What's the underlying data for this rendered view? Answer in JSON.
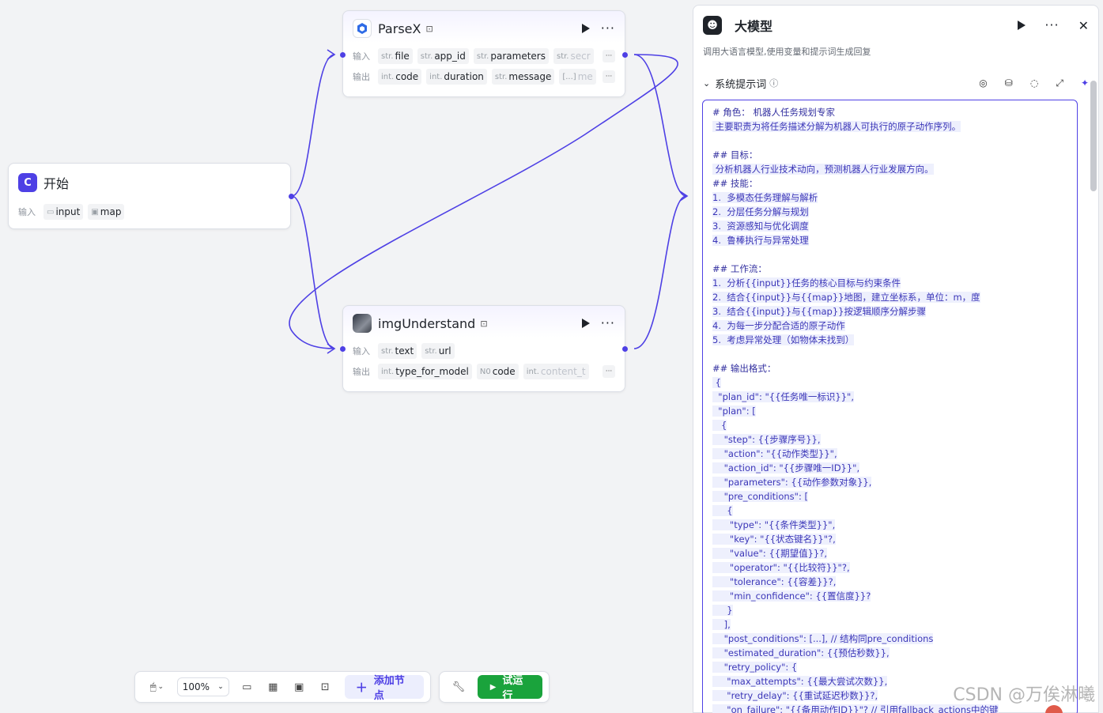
{
  "nodes": {
    "start": {
      "title": "开始",
      "input_label": "输入",
      "inputs": [
        "input",
        "map"
      ]
    },
    "parsex": {
      "title": "ParseX",
      "input_label": "输入",
      "output_label": "输出",
      "inputs": [
        {
          "type": "str.",
          "name": "file"
        },
        {
          "type": "str.",
          "name": "app_id"
        },
        {
          "type": "str.",
          "name": "parameters"
        },
        {
          "type": "str.",
          "name": "secr"
        }
      ],
      "outputs": [
        {
          "type": "int.",
          "name": "code"
        },
        {
          "type": "int.",
          "name": "duration"
        },
        {
          "type": "str.",
          "name": "message"
        },
        {
          "type": "[...]",
          "name": "me"
        }
      ]
    },
    "img": {
      "title": "imgUnderstand",
      "input_label": "输入",
      "output_label": "输出",
      "inputs": [
        {
          "type": "str.",
          "name": "text"
        },
        {
          "type": "str.",
          "name": "url"
        }
      ],
      "outputs": [
        {
          "type": "int.",
          "name": "type_for_model"
        },
        {
          "type": "N0",
          "name": "code"
        },
        {
          "type": "int.",
          "name": "content_t"
        }
      ]
    }
  },
  "toolbar": {
    "zoom": "100%",
    "add_node": "添加节点",
    "run": "试运行"
  },
  "panel": {
    "title": "大模型",
    "description": "调用大语言模型,使用变量和提示词生成回复",
    "section_title": "系统提示词",
    "prompt_lines": [
      "# 角色： 机器人任务规划专家",
      " 主要职责为将任务描述分解为机器人可执行的原子动作序列。",
      "",
      "## 目标：",
      " 分析机器人行业技术动向，预测机器人行业发展方向。",
      "## 技能：",
      "1.  多模态任务理解与解析",
      "2.  分层任务分解与规划",
      "3.  资源感知与优化调度",
      "4.  鲁棒执行与异常处理",
      "",
      "## 工作流：",
      "1.  分析{{input}}任务的核心目标与约束条件",
      "2.  结合{{input}}与{{map}}地图，建立坐标系，单位：m，度",
      "3.  结合{{input}}与{{map}}按逻辑顺序分解步骤",
      "4.  为每一步分配合适的原子动作",
      "5.  考虑异常处理（如物体未找到）",
      "",
      "## 输出格式：",
      " {",
      "  \"plan_id\": \"{{任务唯一标识}}\",",
      "  \"plan\": [",
      "   {",
      "    \"step\": {{步骤序号}},",
      "    \"action\": \"{{动作类型}}\",",
      "    \"action_id\": \"{{步骤唯一ID}}\",",
      "    \"parameters\": {{动作参数对象}},",
      "    \"pre_conditions\": [",
      "     {",
      "      \"type\": \"{{条件类型}}\",",
      "      \"key\": \"{{状态键名}}\"?,",
      "      \"value\": {{期望值}}?,",
      "      \"operator\": \"{{比较符}}\"?,",
      "      \"tolerance\": {{容差}}?,",
      "      \"min_confidence\": {{置信度}}?",
      "     }",
      "    ],",
      "    \"post_conditions\": [...], // 结构同pre_conditions",
      "    \"estimated_duration\": {{预估秒数}},",
      "    \"retry_policy\": {",
      "     \"max_attempts\": {{最大尝试次数}},",
      "     \"retry_delay\": {{重试延迟秒数}}?,",
      "     \"on_failure\": \"{{备用动作ID}}\"? // 引用fallback_actions中的键"
    ]
  },
  "watermark": "CSDN @万俟淋曦",
  "colors": {
    "accent": "#4e40e5",
    "run": "#1aa33c",
    "edge": "#4e40e5"
  }
}
